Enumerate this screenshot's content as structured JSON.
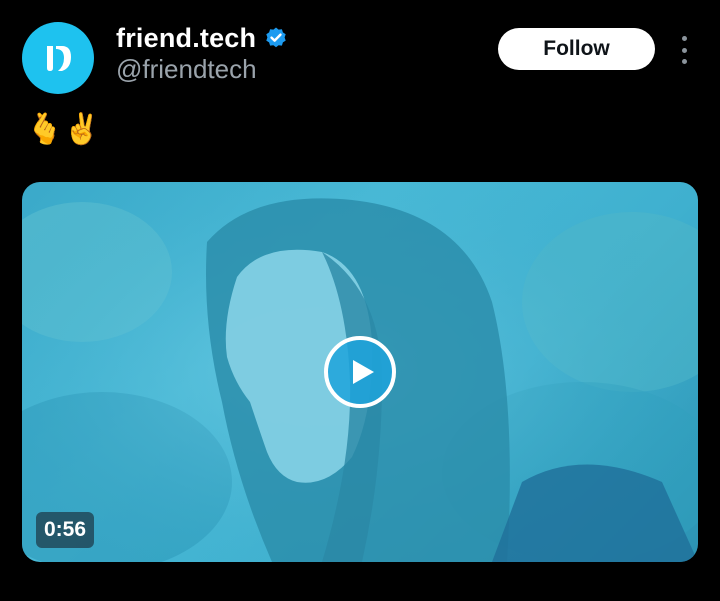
{
  "author": {
    "display_name": "friend.tech",
    "handle": "@friendtech",
    "avatar_icon": "friendtech-logo-icon",
    "avatar_color": "#1ec2ef",
    "verified_icon": "verified-badge-icon",
    "verified_color": "#1d9bf0"
  },
  "actions": {
    "follow_label": "Follow",
    "more_icon": "more-vertical-icon"
  },
  "tweet": {
    "text": "🫰✌️"
  },
  "media": {
    "type": "video",
    "play_icon": "play-icon",
    "accent_color": "#1fa3db",
    "duration": "0:56"
  }
}
